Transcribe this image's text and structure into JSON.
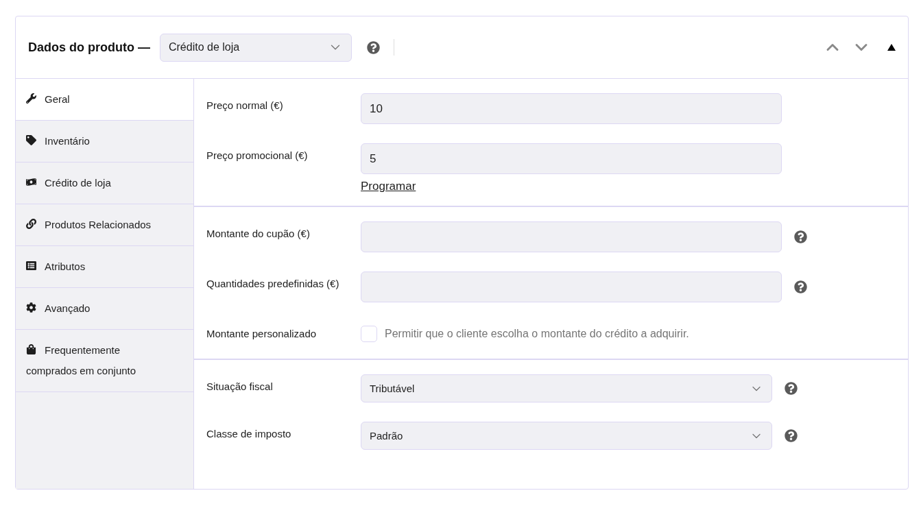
{
  "header": {
    "title": "Dados do produto —",
    "product_type": "Crédito de loja"
  },
  "tabs": [
    {
      "label": "Geral",
      "selected": true
    },
    {
      "label": "Inventário",
      "selected": false
    },
    {
      "label": "Crédito de loja",
      "selected": false
    },
    {
      "label": "Produtos Relacionados",
      "selected": false
    },
    {
      "label": "Atributos",
      "selected": false
    },
    {
      "label": "Avançado",
      "selected": false
    },
    {
      "label": "Frequentemente comprados em conjunto",
      "selected": false
    }
  ],
  "sections": [
    {
      "fields": [
        {
          "kind": "text",
          "label": "Preço normal (€)",
          "value": "10",
          "help": false
        },
        {
          "kind": "text",
          "label": "Preço promocional (€)",
          "value": "5",
          "help": false,
          "link": "Programar"
        }
      ]
    },
    {
      "fields": [
        {
          "kind": "text",
          "label": "Montante do cupão (€)",
          "help": true
        },
        {
          "kind": "text",
          "label": "Quantidades predefinidas (€)",
          "help": true
        },
        {
          "kind": "checkbox",
          "label": "Montante personalizado",
          "description": "Permitir que o cliente escolha o montante do crédito a adquirir.",
          "checked": false
        }
      ]
    },
    {
      "fields": [
        {
          "kind": "select",
          "label": "Situação fiscal",
          "value": "Tributável",
          "help": true
        },
        {
          "kind": "select",
          "label": "Classe de imposto",
          "value": "Padrão",
          "help": true
        }
      ]
    }
  ]
}
